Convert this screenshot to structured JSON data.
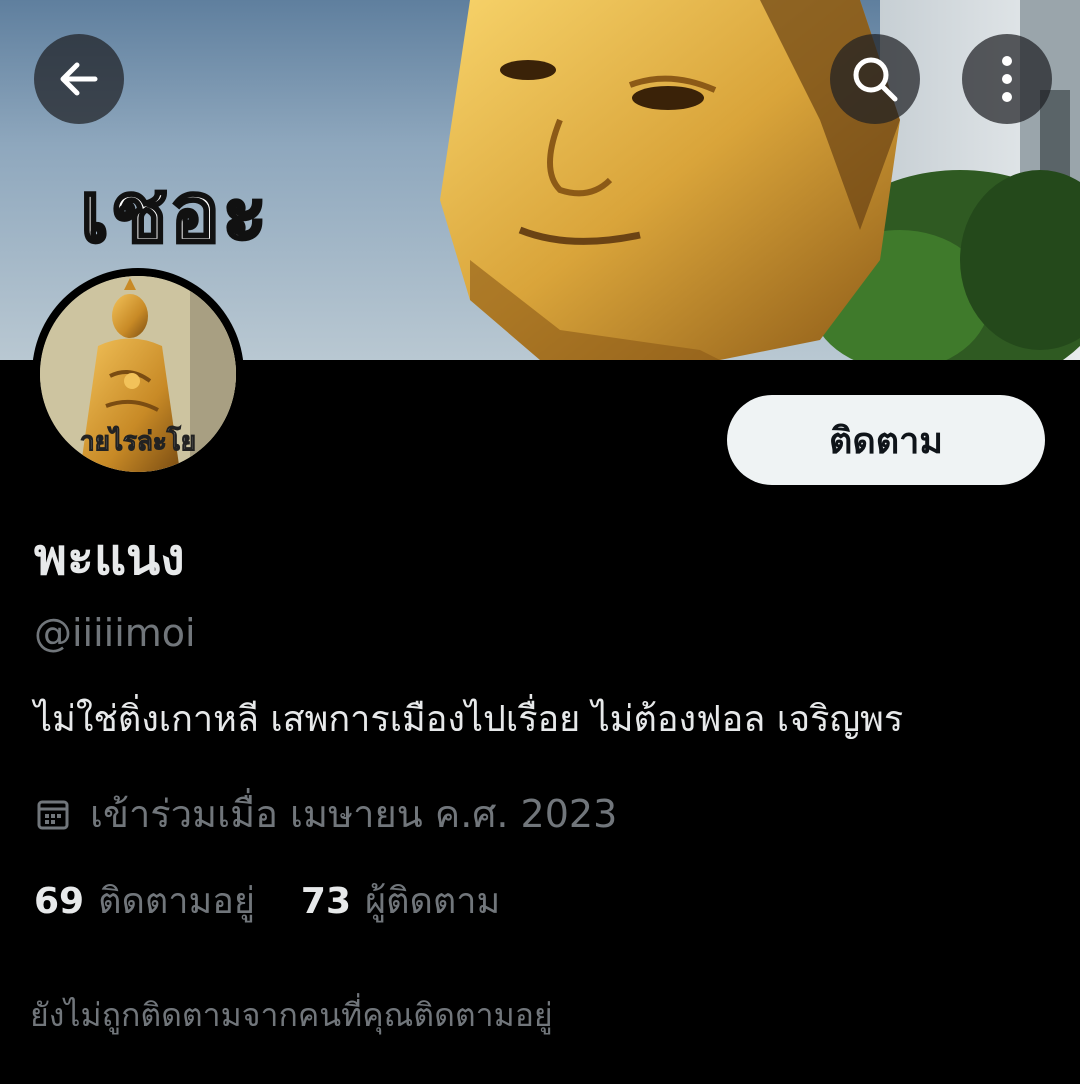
{
  "banner": {
    "caption": "เชอะ",
    "image": "golden-buddha-statue-photo"
  },
  "header": {
    "back_icon": "arrow-left-icon",
    "search_icon": "search-icon",
    "more_icon": "more-vertical-icon"
  },
  "avatar": {
    "image": "golden-buddha-statue-photo",
    "caption": "ายไรล่ะโย"
  },
  "profile": {
    "follow_label": "ติดตาม",
    "display_name": "พะแนง",
    "handle": "@iiiiimoi",
    "bio": "ไม่ใช่ติ่งเกาหลี เสพการเมืองไปเรื่อย ไม่ต้องฟอล เจริญพร",
    "joined": "เข้าร่วมเมื่อ เมษายน ค.ศ. 2023",
    "joined_icon": "calendar-icon",
    "stats": {
      "following_count": "69",
      "following_label": "ติดตามอยู่",
      "followers_count": "73",
      "followers_label": "ผู้ติดตาม"
    },
    "not_followed_note": "ยังไม่ถูกติดตามจากคนที่คุณติดตามอยู่"
  },
  "colors": {
    "background": "#000000",
    "primary_text": "#e7e9ea",
    "secondary_text": "#71767b",
    "follow_button_bg": "#eff3f4",
    "follow_button_text": "#0f1419"
  }
}
